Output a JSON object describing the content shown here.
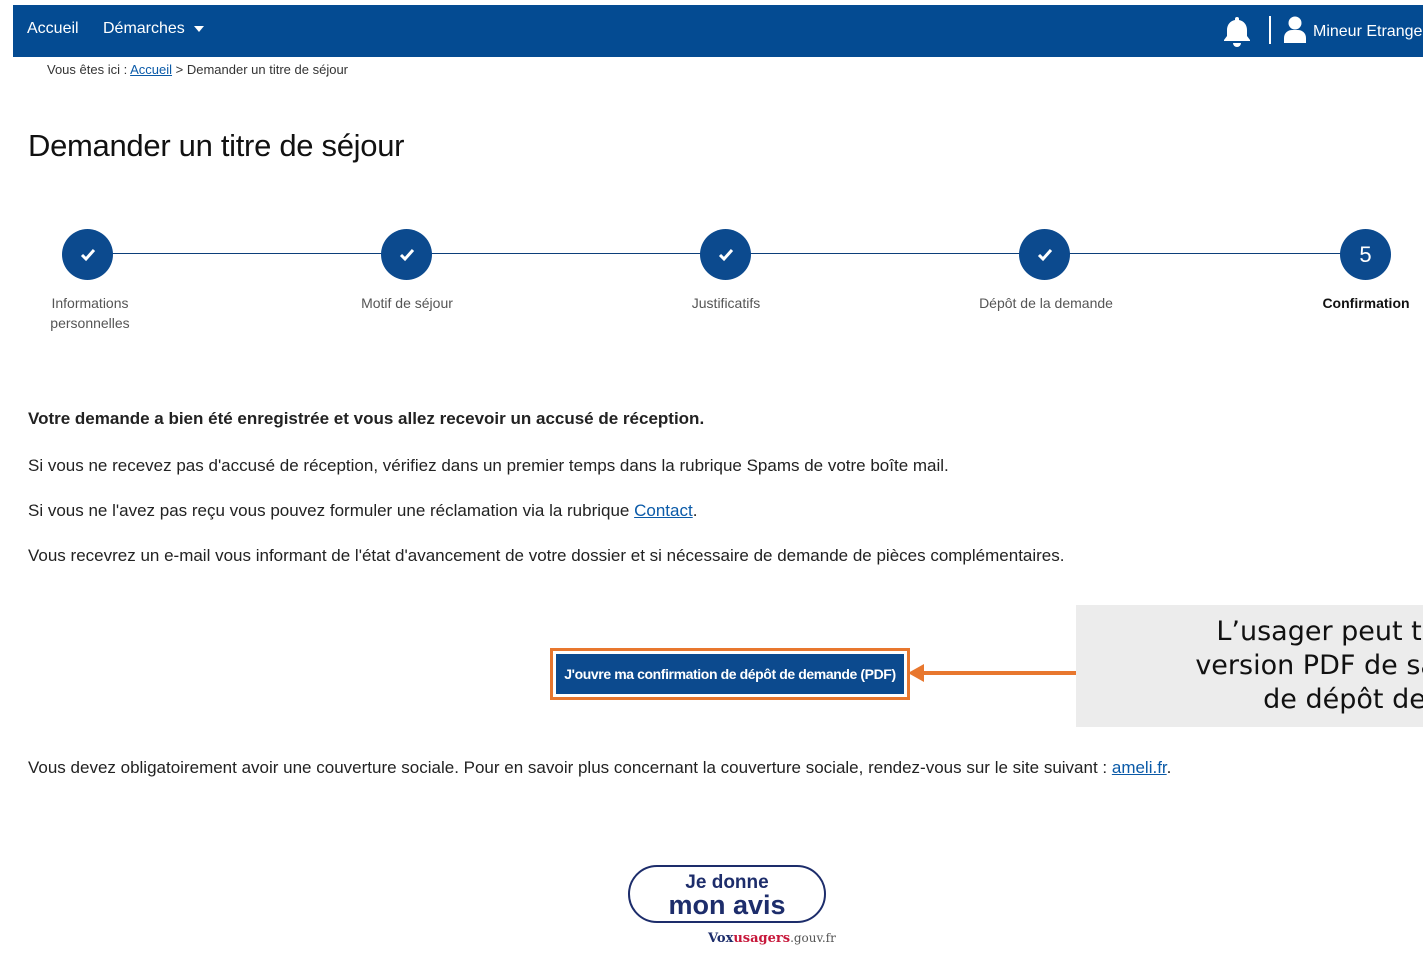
{
  "nav": {
    "home": "Accueil",
    "demarches": "Démarches",
    "user": "Mineur Etranger"
  },
  "breadcrumb": {
    "prefix": "Vous êtes ici : ",
    "home": "Accueil",
    "separator": " > ",
    "current": "Demander un titre de séjour"
  },
  "page_title": "Demander un titre de séjour",
  "stepper": {
    "steps": [
      {
        "label": "Informations personnelles",
        "state": "done"
      },
      {
        "label": "Motif de séjour",
        "state": "done"
      },
      {
        "label": "Justificatifs",
        "state": "done"
      },
      {
        "label": "Dépôt de la demande",
        "state": "done"
      },
      {
        "label": "Confirmation",
        "state": "current",
        "number": "5"
      }
    ]
  },
  "content": {
    "confirmation": "Votre demande a bien été enregistrée et vous allez recevoir un accusé de réception.",
    "spam_notice": "Si vous ne recevez pas d'accusé de réception, vérifiez dans un premier temps dans la rubrique Spams de votre boîte mail.",
    "claim_prefix": "Si vous ne l'avez pas reçu vous pouvez formuler une réclamation via la rubrique ",
    "claim_link": "Contact",
    "claim_suffix": ".",
    "email_notice": "Vous recevrez un e-mail vous informant de l'état d'avancement de votre dossier et si nécessaire de demande de pièces complémentaires.",
    "pdf_button": "J'ouvre ma confirmation de dépôt de demande (PDF)",
    "annotation": "L’usager peut télécha\nversion PDF de sa confi\nde dépôt de dema",
    "social_prefix": "Vous devez obligatoirement avoir une couverture sociale. Pour en savoir plus concernant la couverture sociale, rendez-vous sur le site suivant : ",
    "social_link": "ameli.fr",
    "social_suffix": "."
  },
  "feedback": {
    "line1": "Je donne",
    "line2": "mon avis",
    "brand_vox": "Vox",
    "brand_usagers": "usagers",
    "brand_domain": ".gouv.fr"
  },
  "colors": {
    "navbar": "#044b92",
    "step": "#0c4a8e",
    "highlight": "#e8772e",
    "link": "#0a5aa8"
  },
  "icons": [
    "bell-icon",
    "user-icon",
    "check-icon",
    "chevron-down-icon"
  ]
}
